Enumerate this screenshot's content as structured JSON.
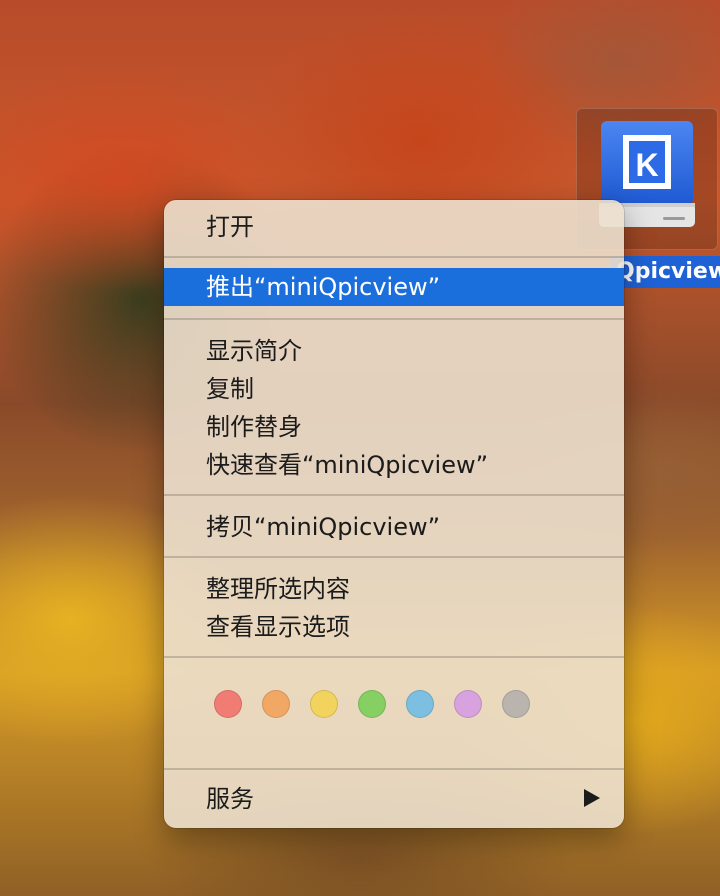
{
  "desktop": {
    "disk_label": "Qpicview"
  },
  "menu": {
    "open": "打开",
    "eject": "推出“miniQpicview”",
    "get_info": "显示简介",
    "duplicate": "复制",
    "make_alias": "制作替身",
    "quick_look": "快速查看“miniQpicview”",
    "copy": "拷贝“miniQpicview”",
    "clean_up": "整理所选内容",
    "view_options": "查看显示选项",
    "services": "服务"
  },
  "tags": [
    {
      "name": "red",
      "color": "#f07c74"
    },
    {
      "name": "orange",
      "color": "#f2a865"
    },
    {
      "name": "yellow",
      "color": "#f2d35e"
    },
    {
      "name": "green",
      "color": "#86cf62"
    },
    {
      "name": "blue",
      "color": "#7cbfe0"
    },
    {
      "name": "purple",
      "color": "#d7a2dd"
    },
    {
      "name": "gray",
      "color": "#b9b4ad"
    }
  ],
  "colors": {
    "highlight": "#1b6fdc",
    "disk_blue": "#2f6ae0"
  },
  "icons": {
    "disk": "external-drive-icon",
    "submenu": "triangle-right-icon"
  }
}
